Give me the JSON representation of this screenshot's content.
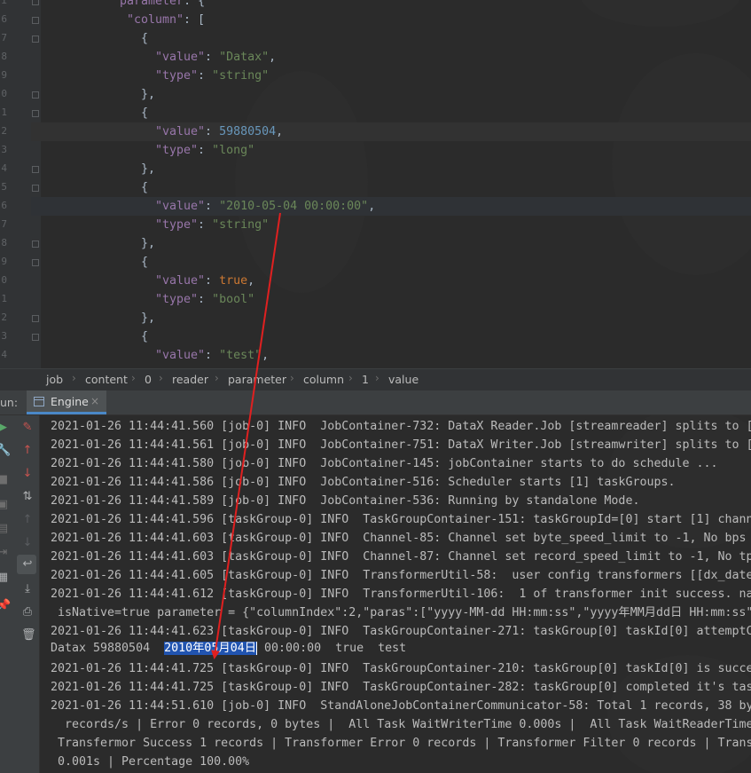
{
  "editor": {
    "gutter_numbers": [
      "i",
      "6",
      "7",
      "8",
      "9",
      "0",
      "1",
      "2",
      "3",
      "4",
      "5",
      "6",
      "7",
      "8",
      "9",
      "0",
      "1",
      "2",
      "3",
      "4"
    ],
    "tokens": {
      "parameter_key": "parameter",
      "column_key": "\"column\"",
      "value_key": "\"value\"",
      "type_key": "\"type\"",
      "open_brace": "{",
      "close_brace_comma": "},",
      "colon": ": ",
      "colon_open_bracket": ": [",
      "comma": ","
    },
    "entries": [
      {
        "value": "\"Datax\"",
        "value_kind": "string",
        "type": "\"string\""
      },
      {
        "value": "59880504",
        "value_kind": "number",
        "type": "\"long\""
      },
      {
        "value": "\"2010-05-04 00:00:00\"",
        "value_kind": "string",
        "type": "\"string\""
      },
      {
        "value": "true",
        "value_kind": "bool",
        "type": "\"bool\""
      },
      {
        "value": "\"test\"",
        "value_kind": "string"
      }
    ]
  },
  "breadcrumb": [
    "job",
    "content",
    "0",
    "reader",
    "parameter",
    "column",
    "1",
    "value"
  ],
  "run_panel": {
    "label": "un:",
    "tab_label": "Engine",
    "tab_close": "×"
  },
  "console": {
    "lines": [
      "2021-01-26 11:44:41.560 [job-0] INFO  JobContainer-732: DataX Reader.Job [streamreader] splits to [",
      "2021-01-26 11:44:41.561 [job-0] INFO  JobContainer-751: DataX Writer.Job [streamwriter] splits to [",
      "2021-01-26 11:44:41.580 [job-0] INFO  JobContainer-145: jobContainer starts to do schedule ...",
      "2021-01-26 11:44:41.586 [job-0] INFO  JobContainer-516: Scheduler starts [1] taskGroups.",
      "2021-01-26 11:44:41.589 [job-0] INFO  JobContainer-536: Running by standalone Mode.",
      "2021-01-26 11:44:41.596 [taskGroup-0] INFO  TaskGroupContainer-151: taskGroupId=[0] start [1] chann",
      "2021-01-26 11:44:41.603 [taskGroup-0] INFO  Channel-85: Channel set byte_speed_limit to -1, No bps",
      "2021-01-26 11:44:41.603 [taskGroup-0] INFO  Channel-87: Channel set record_speed_limit to -1, No tp",
      "2021-01-26 11:44:41.605 [taskGroup-0] INFO  TransformerUtil-58:  user config transformers [[dx_date",
      "2021-01-26 11:44:41.612 [taskGroup-0] INFO  TransformerUtil-106:  1 of transformer init success. na",
      " isNative=true parameter = {\"columnIndex\":2,\"paras\":[\"yyyy-MM-dd HH:mm:ss\",\"yyyy年MM月dd日 HH:mm:ss\"",
      "2021-01-26 11:44:41.623 [taskGroup-0] INFO  TaskGroupContainer-271: taskGroup[0] taskId[0] attemptC",
      "",
      "2021-01-26 11:44:41.725 [taskGroup-0] INFO  TaskGroupContainer-210: taskGroup[0] taskId[0] is succe",
      "2021-01-26 11:44:41.725 [taskGroup-0] INFO  TaskGroupContainer-282: taskGroup[0] completed it's tas",
      "2021-01-26 11:44:51.610 [job-0] INFO  StandAloneJobContainerCommunicator-58: Total 1 records, 38 by",
      "  records/s | Error 0 records, 0 bytes |  All Task WaitWriterTime 0.000s |  All Task WaitReaderTime",
      " Transfermor Success 1 records | Transformer Error 0 records | Transformer Filter 0 records | Trans",
      " 0.001s | Percentage 100.00%"
    ],
    "output_before": "Datax 59880504  ",
    "output_selected": "2010年05月04日",
    "output_after": " 00:00:00  true  test"
  },
  "colors": {
    "key": "#9876aa",
    "string": "#6a8759",
    "number": "#6897bb",
    "keyword": "#cc7832",
    "selection": "#2154b0",
    "annotation_arrow": "#e02020"
  }
}
